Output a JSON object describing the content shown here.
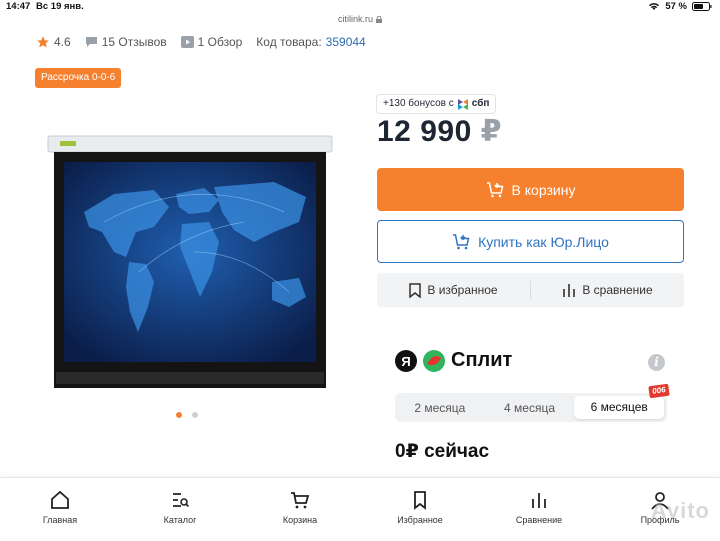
{
  "status_bar": {
    "time": "14:47",
    "date": "Вс 19 янв.",
    "battery": "57 %"
  },
  "browser": {
    "url": "citilink.ru"
  },
  "product_meta": {
    "rating": "4.6",
    "reviews": "15 Отзывов",
    "overviews": "1 Обзор",
    "code_label": "Код товара:",
    "code_value": "359044"
  },
  "installment_badge": "Рассрочка 0-0-6",
  "gallery": {
    "slides": 2,
    "active_slide": 1
  },
  "bonus": {
    "text": "+130 бонусов с",
    "partner": "сбп"
  },
  "price": {
    "amount": "12 990",
    "currency": "₽"
  },
  "buttons": {
    "add_to_cart": "В корзину",
    "buy_legal": "Купить как Юр.Лицо",
    "favorites": "В избранное",
    "compare": "В сравнение"
  },
  "split": {
    "brand": "Сплит",
    "tabs": [
      "2 месяца",
      "4 месяца",
      "6 месяцев"
    ],
    "active_tab": "6 месяцев",
    "promo_tag": "006",
    "now_text": "0₽ сейчас"
  },
  "bottom_nav": [
    "Главная",
    "Каталог",
    "Корзина",
    "Избранное",
    "Сравнение",
    "Профиль"
  ],
  "colors": {
    "accent": "#f5802e",
    "link": "#2f74c0",
    "text": "#1f2633"
  }
}
